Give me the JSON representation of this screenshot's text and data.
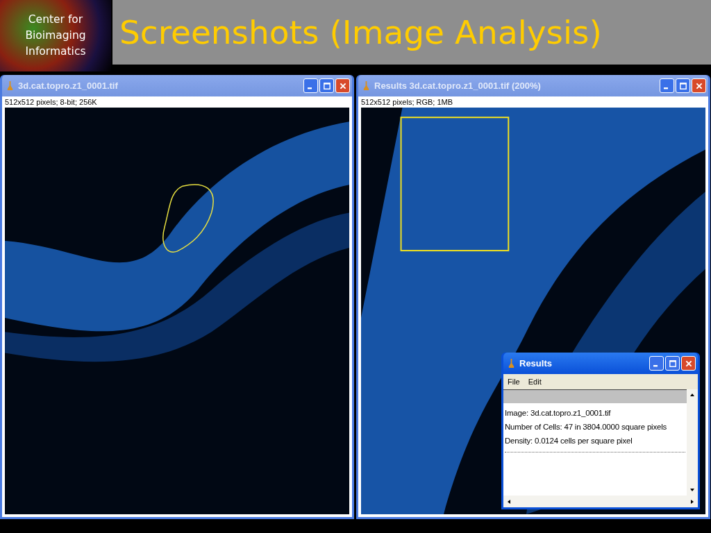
{
  "logo": {
    "text": "Center for Bioimaging Informatics"
  },
  "slide_title": "Screenshots (Image Analysis)",
  "windows": [
    {
      "title": "3d.cat.topro.z1_0001.tif",
      "info": "512x512 pixels; 8-bit; 256K",
      "active": false,
      "kind": "outline"
    },
    {
      "title": "Results 3d.cat.topro.z1_0001.tif (200%)",
      "info": "512x512 pixels; RGB; 1MB",
      "active": false,
      "kind": "rectangle"
    }
  ],
  "results_window": {
    "title": "Results",
    "active": true,
    "menu": [
      "File",
      "Edit"
    ],
    "lines": [
      "Image: 3d.cat.topro.z1_0001.tif",
      "Number of Cells: 47 in 3804.0000 square pixels",
      "Density: 0.0124 cells per square pixel"
    ]
  }
}
